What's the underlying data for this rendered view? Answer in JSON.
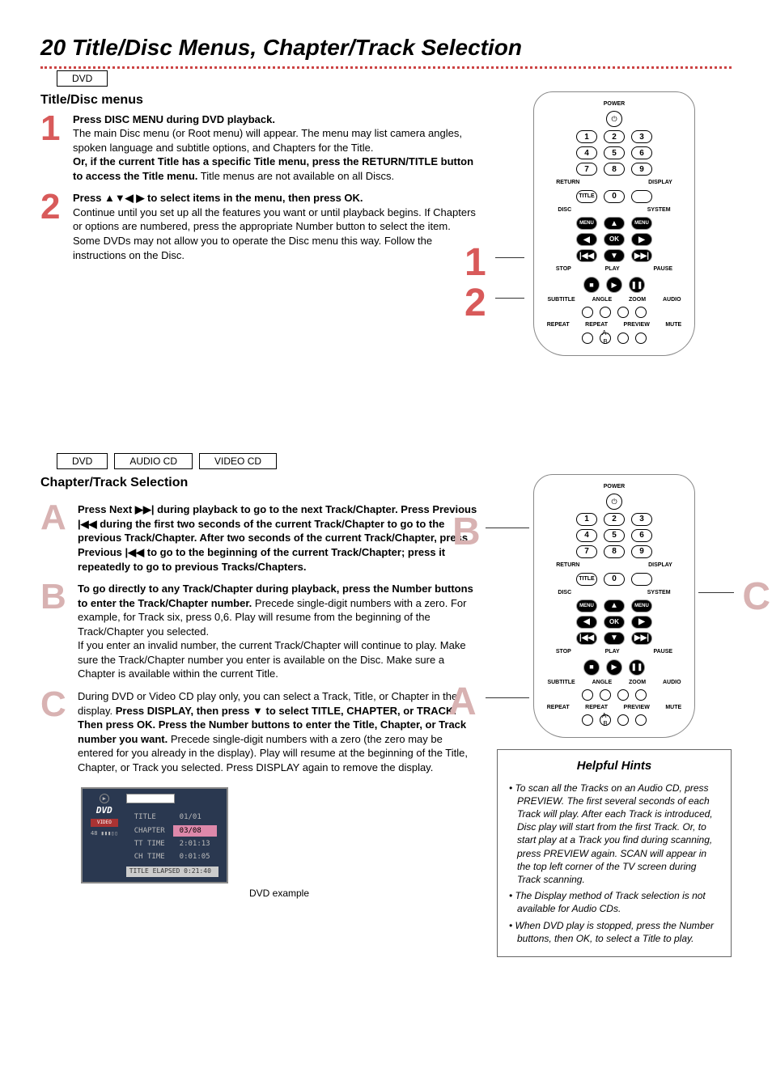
{
  "page_title": "20 Title/Disc Menus, Chapter/Track Selection",
  "tags": {
    "dvd": "DVD",
    "audio_cd": "AUDIO CD",
    "video_cd": "VIDEO CD"
  },
  "section1": {
    "heading": "Title/Disc menus",
    "step1": {
      "lead": "Press DISC MENU during DVD playback.",
      "body": "The main Disc menu (or Root menu) will appear. The menu may list camera angles, spoken language and subtitle options, and Chapters for the Title.",
      "lead2": "Or, if the current Title has a specific Title menu, press the RETURN/TITLE button to access the Title menu.",
      "body2": "Title menus are not available on all Discs."
    },
    "step2": {
      "lead": "Press ▲▼◀ ▶ to select items in the menu, then press OK.",
      "body": "Continue until you set up all the features you want or until playback begins. If Chapters or options are numbered, press the appropriate Number button to select the item. Some DVDs may not allow you to operate the Disc menu this way. Follow the instructions on the Disc."
    }
  },
  "section2": {
    "heading": "Chapter/Track Selection",
    "stepA": {
      "lead": "Press Next ▶▶| during playback to go to the next Track/Chapter. Press Previous |◀◀ during the first two seconds of the current Track/Chapter to go to the previous Track/Chapter.  After two seconds of the current Track/Chapter, press Previous |◀◀  to go to the beginning of the current Track/Chapter; press it repeatedly to go to previous Tracks/Chapters."
    },
    "stepB": {
      "lead": "To go directly to any Track/Chapter during playback, press the Number buttons to enter the Track/Chapter number.",
      "body": "Precede single-digit numbers with a zero. For example, for Track six, press 0,6. Play will resume from the beginning of the Track/Chapter you selected.",
      "body2": "If you enter an invalid number, the current Track/Chapter will continue to play. Make sure the Track/Chapter number you enter is available on the Disc. Make sure a Chapter is available within the current Title."
    },
    "stepC": {
      "body_pre": "During DVD or Video CD play only, you can select a Track, Title, or Chapter in the display. ",
      "lead": "Press DISPLAY, then press ▼ to select TITLE, CHAPTER, or TRACK. Then press OK. Press the Number buttons to enter the Title, Chapter, or Track number you want.",
      "body_post": " Precede single-digit numbers with a zero (the zero may be entered for you already in the display). Play will resume at the beginning of the Title, Chapter, or Track you selected. Press DISPLAY again to remove the display."
    }
  },
  "osd": {
    "title_row": {
      "label": "TITLE",
      "value": "01/01"
    },
    "chapter_row": {
      "label": "CHAPTER",
      "value": "03/08"
    },
    "tt_time": {
      "label": "TT TIME",
      "value": "2:01:13"
    },
    "ch_time": {
      "label": "CH TIME",
      "value": "0:01:05"
    },
    "footer": "TITLE ELAPSED 0:21:40",
    "caption": "DVD example",
    "dvd_label": "DVD",
    "video_label": "VIDEO",
    "quality": "48"
  },
  "hints": {
    "title": "Helpful Hints",
    "items": [
      "To scan all the Tracks on an Audio CD, press PREVIEW.  The first several seconds of each Track will play.  After each Track is introduced, Disc play will start from the first Track. Or, to start play at a Track you find during scanning, press PREVIEW again. SCAN will appear in the top left corner of the TV screen during Track scanning.",
      "The Display method of Track selection is not available for Audio CDs.",
      "When DVD play is stopped, press the Number buttons, then OK, to select a Title to play."
    ]
  },
  "remote": {
    "power": "POWER",
    "return": "RETURN",
    "display": "DISPLAY",
    "title_btn": "TITLE",
    "disc": "DISC",
    "system": "SYSTEM",
    "menu": "MENU",
    "ok": "OK",
    "stop": "STOP",
    "play": "PLAY",
    "pause": "PAUSE",
    "subtitle": "SUBTITLE",
    "angle": "ANGLE",
    "zoom": "ZOOM",
    "audio": "AUDIO",
    "repeat": "REPEAT",
    "repeat2": "REPEAT",
    "preview": "PREVIEW",
    "mute": "MUTE",
    "ab": "A-B"
  },
  "callouts": {
    "r1": "1",
    "r2": "2",
    "rA": "A",
    "rB": "B",
    "rC": "C"
  }
}
